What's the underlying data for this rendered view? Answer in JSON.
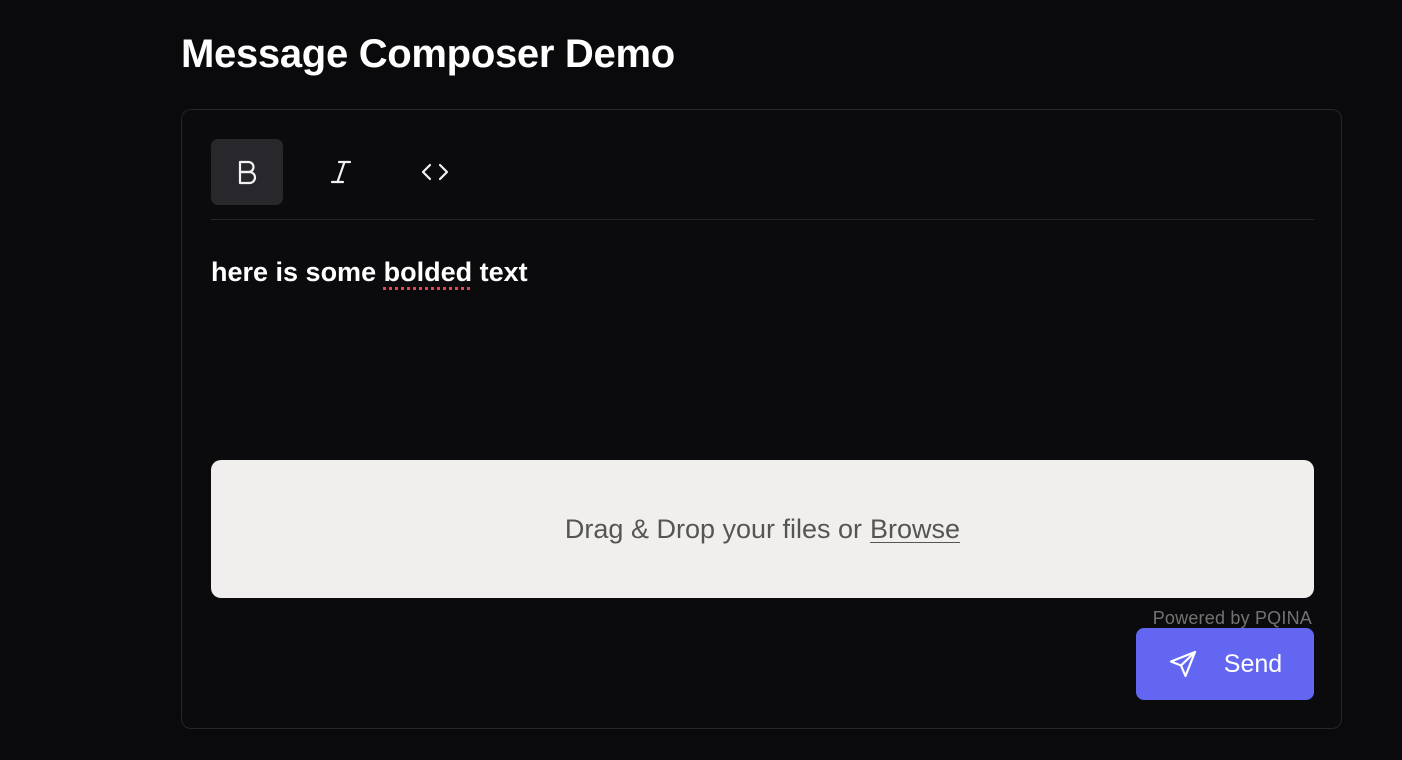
{
  "page": {
    "title": "Message Composer Demo"
  },
  "toolbar": {
    "buttons": [
      {
        "name": "bold",
        "icon": "bold-icon",
        "active": true
      },
      {
        "name": "italic",
        "icon": "italic-icon",
        "active": false
      },
      {
        "name": "code",
        "icon": "code-icon",
        "active": false
      }
    ]
  },
  "editor": {
    "text_before": "here is some ",
    "text_misspelled": "bolded",
    "text_after": " text"
  },
  "dropzone": {
    "label": "Drag & Drop your files or",
    "browse_label": "Browse",
    "credit": "Powered by PQINA"
  },
  "send_button": {
    "label": "Send",
    "icon": "paper-plane-icon",
    "color": "#6366f1"
  },
  "colors": {
    "background": "#0a0a0c",
    "active_tool": "#28282c",
    "dropzone_bg": "#f0efed",
    "spellcheck": "#e5484d"
  }
}
